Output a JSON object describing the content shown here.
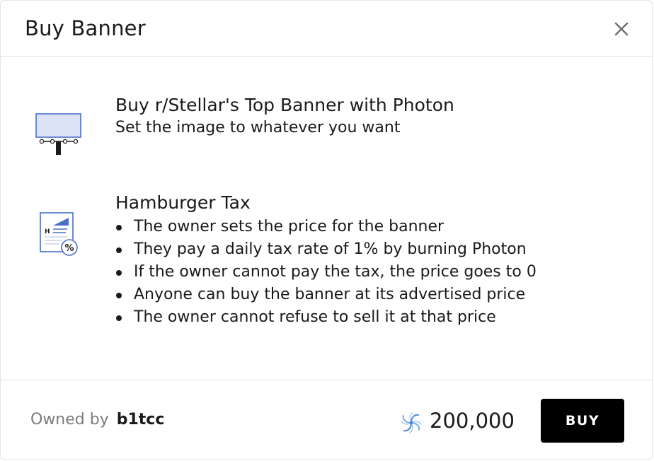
{
  "modal": {
    "title": "Buy Banner",
    "close_icon": "close-icon"
  },
  "banner_section": {
    "icon": "billboard-icon",
    "title": "Buy r/Stellar's Top Banner with Photon",
    "subtitle": "Set the image to whatever you want"
  },
  "tax_section": {
    "icon": "tax-document-icon",
    "title": "Hamburger Tax",
    "bullets": [
      "The owner sets the price for the banner",
      "They pay a daily tax rate of 1% by burning Photon",
      "If the owner cannot pay the tax, the price goes to 0",
      "Anyone can buy the banner at its advertised price",
      "The owner cannot refuse to sell it at that price"
    ]
  },
  "footer": {
    "owned_label": "Owned by",
    "owner": "b1tcc",
    "currency_icon": "photon-icon",
    "price": "200,000",
    "buy_label": "BUY"
  },
  "colors": {
    "accent_blue": "#4a6fc4",
    "light_blue_fill": "#dde3f6",
    "button_bg": "#000000",
    "muted_text": "#7c7c7c"
  }
}
